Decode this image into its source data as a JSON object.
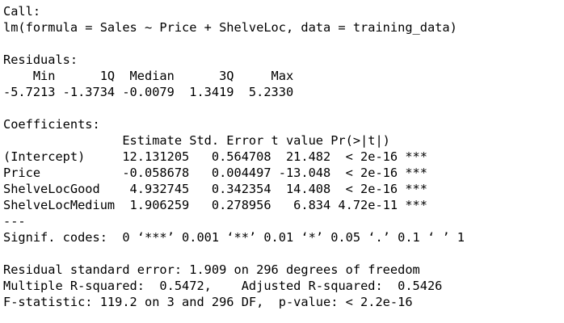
{
  "call": {
    "header": "Call:",
    "formula": "lm(formula = Sales ~ Price + ShelveLoc, data = training_data)"
  },
  "residuals": {
    "header": "Residuals:",
    "labels": "    Min      1Q  Median      3Q     Max ",
    "values": "-5.7213 -1.3734 -0.0079  1.3419  5.2330 "
  },
  "coefficients": {
    "header": "Coefficients:",
    "columns": "                Estimate Std. Error t value Pr(>|t|)    ",
    "rows": [
      "(Intercept)     12.131205   0.564708  21.482  < 2e-16 ***",
      "Price           -0.058678   0.004497 -13.048  < 2e-16 ***",
      "ShelveLocGood    4.932745   0.342354  14.408  < 2e-16 ***",
      "ShelveLocMedium  1.906259   0.278956   6.834 4.72e-11 ***"
    ],
    "separator": "---",
    "signif_codes": "Signif. codes:  0 ‘***’ 0.001 ‘**’ 0.01 ‘*’ 0.05 ‘.’ 0.1 ‘ ’ 1"
  },
  "summary": {
    "residual_se": "Residual standard error: 1.909 on 296 degrees of freedom",
    "r_squared": "Multiple R-squared:  0.5472,\tAdjusted R-squared:  0.5426 ",
    "f_statistic": "F-statistic: 119.2 on 3 and 296 DF,  p-value: < 2.2e-16"
  }
}
